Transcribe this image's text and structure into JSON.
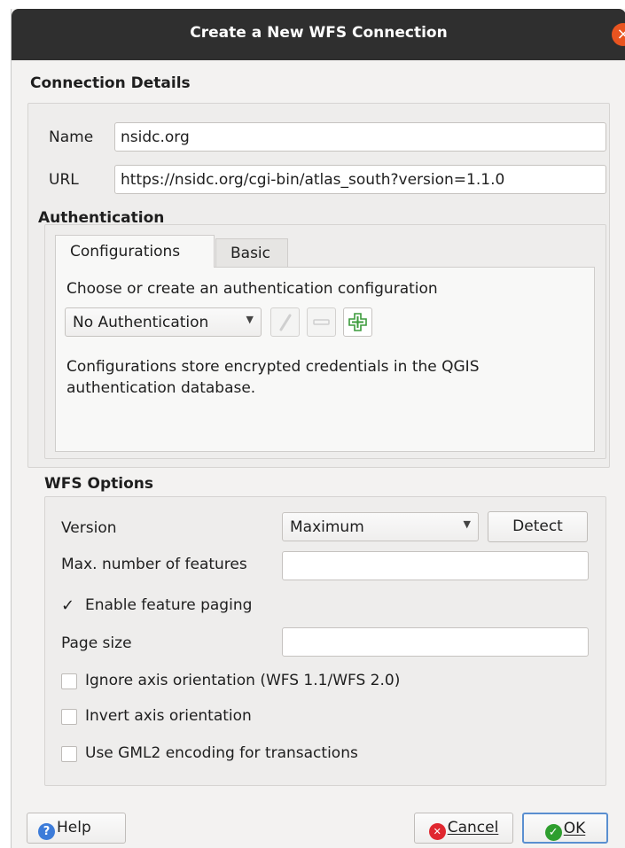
{
  "window": {
    "title": "Create a New WFS Connection",
    "close_icon_glyph": "×"
  },
  "connection_details": {
    "title": "Connection Details",
    "name_label": "Name",
    "name_value": "nsidc.org",
    "url_label": "URL",
    "url_value": "https://nsidc.org/cgi-bin/atlas_south?version=1.1.0"
  },
  "authentication": {
    "title": "Authentication",
    "tabs": [
      {
        "label": "Configurations",
        "active": true
      },
      {
        "label": "Basic",
        "active": false
      }
    ],
    "choose_label": "Choose or create an authentication configuration",
    "config_select_value": "No Authentication",
    "info_text": "Configurations store encrypted credentials in the QGIS authentication database.",
    "icons": [
      "edit-icon",
      "remove-icon",
      "add-icon"
    ]
  },
  "wfs_options": {
    "title": "WFS Options",
    "version_label": "Version",
    "version_value": "Maximum",
    "detect_label": "Detect",
    "max_features_label": "Max. number of features",
    "max_features_value": "",
    "enable_paging_label": "Enable feature paging",
    "enable_paging_checked": true,
    "page_size_label": "Page size",
    "page_size_value": "",
    "ignore_axis_label": "Ignore axis orientation (WFS 1.1/WFS 2.0)",
    "ignore_axis_checked": false,
    "invert_axis_label": "Invert axis orientation",
    "invert_axis_checked": false,
    "gml2_label": "Use GML2 encoding for transactions",
    "gml2_checked": false
  },
  "buttons": {
    "help": "Help",
    "cancel": "Cancel",
    "ok": "OK",
    "help_icon_glyph": "?",
    "cancel_icon_glyph": "✕",
    "ok_icon_glyph": "✓"
  },
  "colors": {
    "titlebar": "#2f2f2f",
    "close_button": "#e95420",
    "help_icon": "#3d7cd9",
    "cancel_icon": "#e0272f",
    "ok_icon": "#2e9e2e",
    "ok_border": "#5a8fd0"
  }
}
